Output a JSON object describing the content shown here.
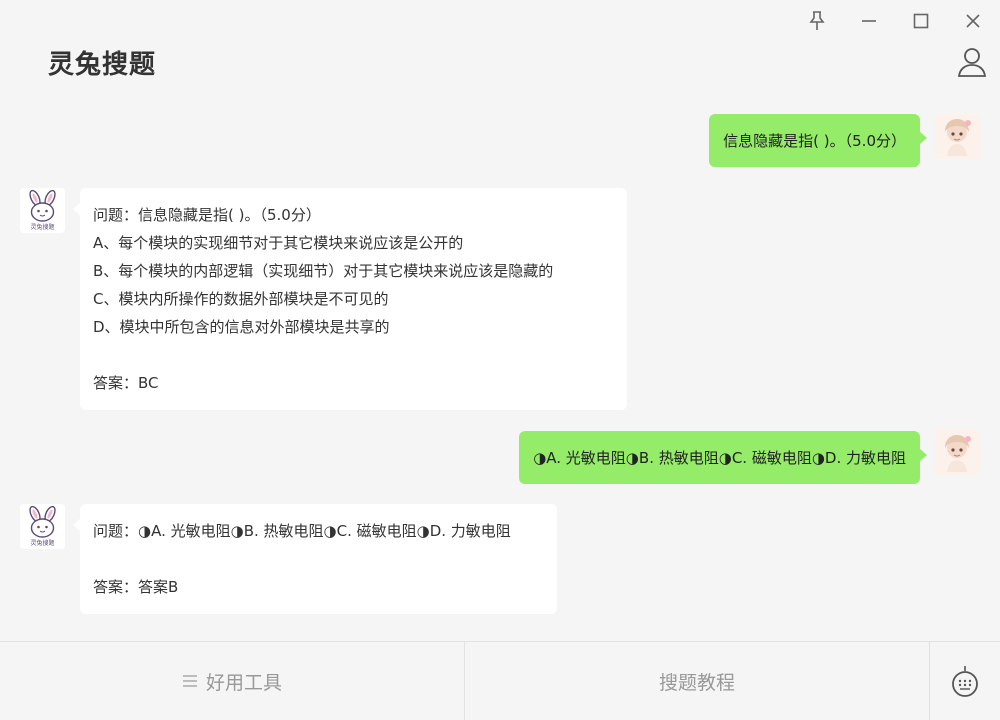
{
  "app": {
    "title": "灵兔搜题"
  },
  "window_controls": [
    "pin-icon",
    "minimize-icon",
    "maximize-icon",
    "close-icon"
  ],
  "messages": [
    {
      "from": "user",
      "text": "信息隐藏是指( )。（5.0分）"
    },
    {
      "from": "bot",
      "lines": [
        "问题：信息隐藏是指( )。（5.0分）",
        "A、每个模块的实现细节对于其它模块来说应该是公开的",
        "B、每个模块的内部逻辑（实现细节）对于其它模块来说应该是隐藏的",
        "C、模块内所操作的数据外部模块是不可见的",
        "D、模块中所包含的信息对外部模块是共享的",
        "",
        "答案：BC"
      ]
    },
    {
      "from": "user",
      "text": "◑A. 光敏电阻◑B. 热敏电阻◑C. 磁敏电阻◑D. 力敏电阻"
    },
    {
      "from": "bot",
      "lines": [
        "问题：◑A. 光敏电阻◑B. 热敏电阻◑C. 磁敏电阻◑D. 力敏电阻",
        "",
        "答案：答案B"
      ]
    }
  ],
  "bot_avatar": {
    "label": "灵兔搜题"
  },
  "bottom_bar": {
    "tools_label": "好用工具",
    "tutorial_label": "搜题教程"
  },
  "colors": {
    "background": "#f5f5f5",
    "user_bubble": "#95ec69",
    "bot_bubble": "#ffffff",
    "muted_text": "#999999"
  }
}
